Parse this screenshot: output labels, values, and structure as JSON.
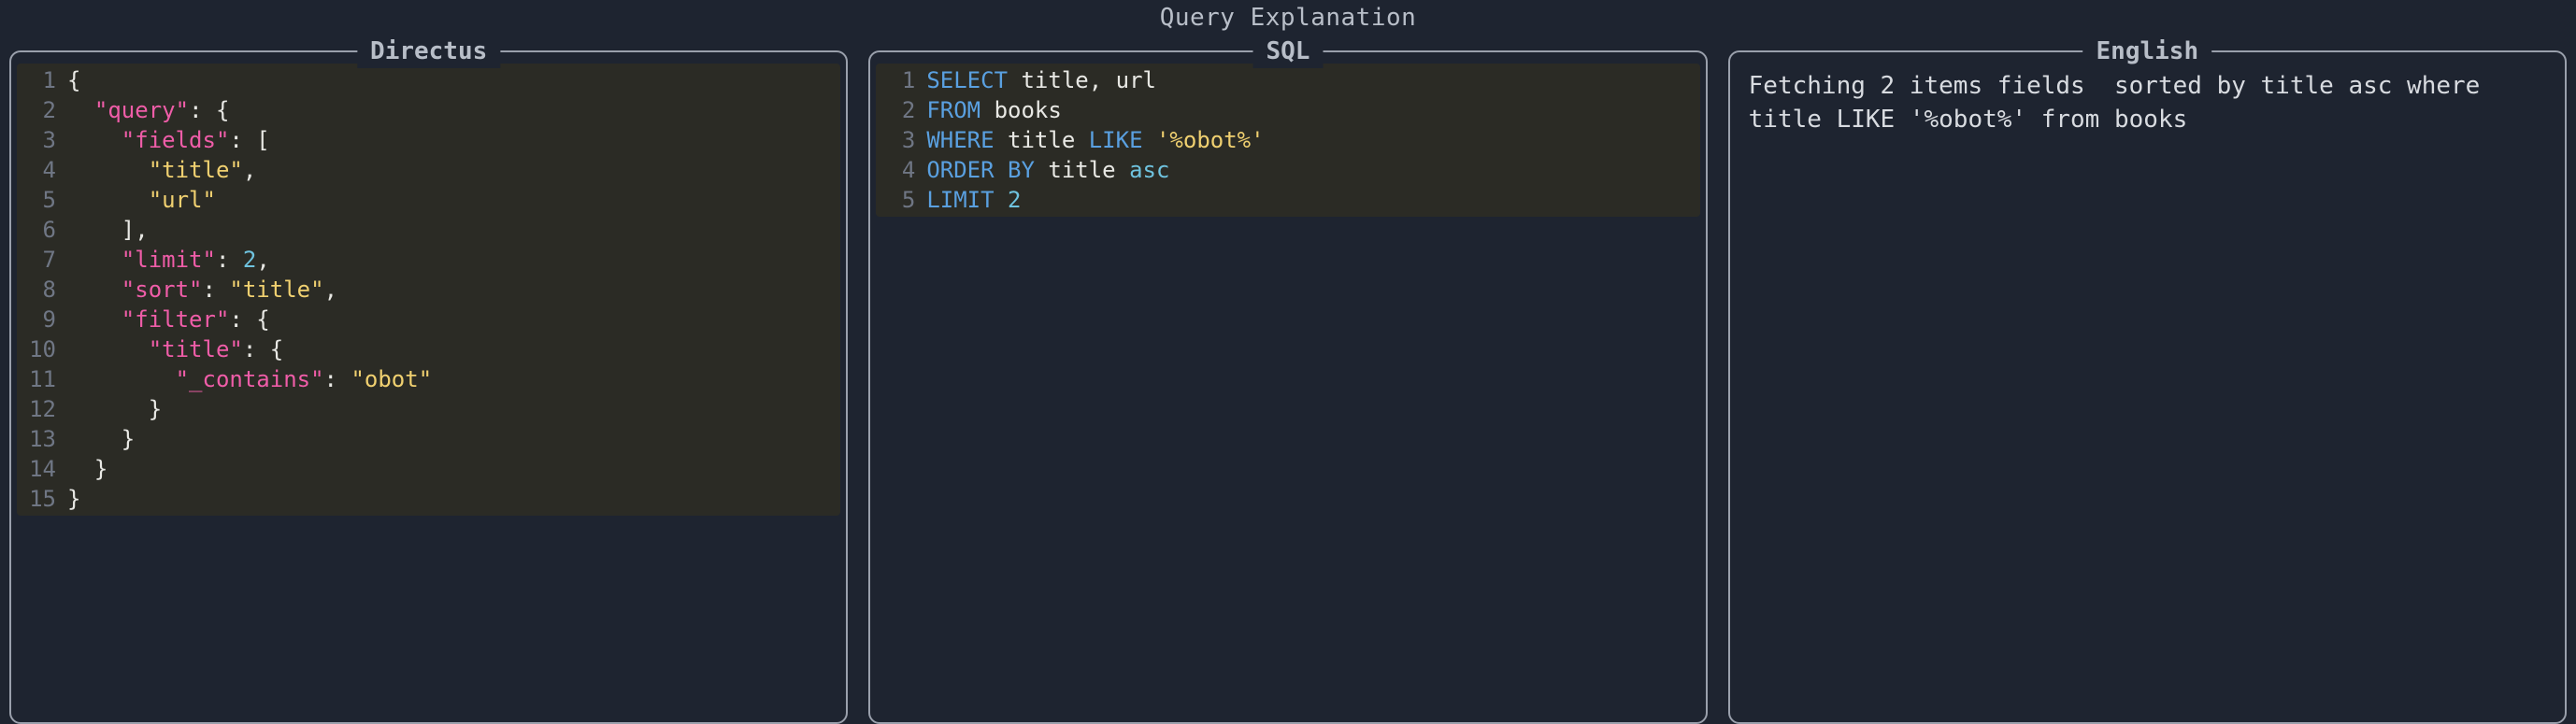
{
  "page_title": "Query Explanation",
  "panels": {
    "directus": {
      "label": "Directus"
    },
    "sql": {
      "label": "SQL"
    },
    "english": {
      "label": "English"
    }
  },
  "directus_code": {
    "lines": [
      {
        "n": 1,
        "tokens": [
          {
            "t": "{",
            "c": "punct"
          }
        ]
      },
      {
        "n": 2,
        "tokens": [
          {
            "t": "  ",
            "c": "punct"
          },
          {
            "t": "\"query\"",
            "c": "key"
          },
          {
            "t": ": {",
            "c": "punct"
          }
        ]
      },
      {
        "n": 3,
        "tokens": [
          {
            "t": "    ",
            "c": "punct"
          },
          {
            "t": "\"fields\"",
            "c": "key"
          },
          {
            "t": ": [",
            "c": "punct"
          }
        ]
      },
      {
        "n": 4,
        "tokens": [
          {
            "t": "      ",
            "c": "punct"
          },
          {
            "t": "\"title\"",
            "c": "string"
          },
          {
            "t": ",",
            "c": "punct"
          }
        ]
      },
      {
        "n": 5,
        "tokens": [
          {
            "t": "      ",
            "c": "punct"
          },
          {
            "t": "\"url\"",
            "c": "string"
          }
        ]
      },
      {
        "n": 6,
        "tokens": [
          {
            "t": "    ],",
            "c": "punct"
          }
        ]
      },
      {
        "n": 7,
        "tokens": [
          {
            "t": "    ",
            "c": "punct"
          },
          {
            "t": "\"limit\"",
            "c": "key"
          },
          {
            "t": ": ",
            "c": "punct"
          },
          {
            "t": "2",
            "c": "number"
          },
          {
            "t": ",",
            "c": "punct"
          }
        ]
      },
      {
        "n": 8,
        "tokens": [
          {
            "t": "    ",
            "c": "punct"
          },
          {
            "t": "\"sort\"",
            "c": "key"
          },
          {
            "t": ": ",
            "c": "punct"
          },
          {
            "t": "\"title\"",
            "c": "string"
          },
          {
            "t": ",",
            "c": "punct"
          }
        ]
      },
      {
        "n": 9,
        "tokens": [
          {
            "t": "    ",
            "c": "punct"
          },
          {
            "t": "\"filter\"",
            "c": "key"
          },
          {
            "t": ": {",
            "c": "punct"
          }
        ]
      },
      {
        "n": 10,
        "tokens": [
          {
            "t": "      ",
            "c": "punct"
          },
          {
            "t": "\"title\"",
            "c": "key"
          },
          {
            "t": ": {",
            "c": "punct"
          }
        ]
      },
      {
        "n": 11,
        "tokens": [
          {
            "t": "        ",
            "c": "punct"
          },
          {
            "t": "\"_contains\"",
            "c": "key"
          },
          {
            "t": ": ",
            "c": "punct"
          },
          {
            "t": "\"obot\"",
            "c": "string"
          }
        ]
      },
      {
        "n": 12,
        "tokens": [
          {
            "t": "      }",
            "c": "punct"
          }
        ]
      },
      {
        "n": 13,
        "tokens": [
          {
            "t": "    }",
            "c": "punct"
          }
        ]
      },
      {
        "n": 14,
        "tokens": [
          {
            "t": "  }",
            "c": "punct"
          }
        ]
      },
      {
        "n": 15,
        "tokens": [
          {
            "t": "}",
            "c": "punct"
          }
        ]
      }
    ]
  },
  "sql_code": {
    "lines": [
      {
        "n": 1,
        "tokens": [
          {
            "t": "SELECT",
            "c": "kw"
          },
          {
            "t": " ",
            "c": "ident"
          },
          {
            "t": "title, url",
            "c": "ident"
          }
        ]
      },
      {
        "n": 2,
        "tokens": [
          {
            "t": "FROM",
            "c": "kw"
          },
          {
            "t": " ",
            "c": "ident"
          },
          {
            "t": "books",
            "c": "ident"
          }
        ]
      },
      {
        "n": 3,
        "tokens": [
          {
            "t": "WHERE",
            "c": "kw"
          },
          {
            "t": " ",
            "c": "ident"
          },
          {
            "t": "title ",
            "c": "ident"
          },
          {
            "t": "LIKE",
            "c": "kw"
          },
          {
            "t": " ",
            "c": "ident"
          },
          {
            "t": "'%obot%'",
            "c": "string"
          }
        ]
      },
      {
        "n": 4,
        "tokens": [
          {
            "t": "ORDER BY",
            "c": "kw"
          },
          {
            "t": " ",
            "c": "ident"
          },
          {
            "t": "title ",
            "c": "ident"
          },
          {
            "t": "asc",
            "c": "number"
          }
        ]
      },
      {
        "n": 5,
        "tokens": [
          {
            "t": "LIMIT",
            "c": "kw"
          },
          {
            "t": " ",
            "c": "ident"
          },
          {
            "t": "2",
            "c": "number"
          }
        ]
      }
    ]
  },
  "english_text": "Fetching 2 items fields  sorted by title asc where title LIKE '%obot%' from books"
}
